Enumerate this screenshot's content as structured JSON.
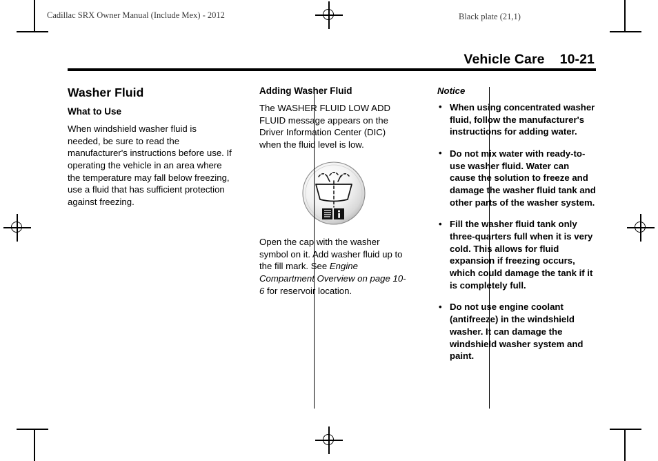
{
  "running_head": {
    "left": "Cadillac SRX Owner Manual (Include Mex) - 2012",
    "right": "Black plate (21,1)"
  },
  "page_header": {
    "section_title": "Vehicle Care",
    "page_number": "10-21"
  },
  "columns": {
    "left": {
      "heading": "Washer Fluid",
      "subheading": "What to Use",
      "paragraph": "When windshield washer fluid is needed, be sure to read the manufacturer's instructions before use. If operating the vehicle in an area where the temperature may fall below freezing, use a fluid that has sufficient protection against freezing."
    },
    "middle": {
      "heading": "Adding Washer Fluid",
      "paragraph_1": "The WASHER FLUID LOW ADD FLUID message appears on the Driver Information Center (DIC) when the fluid level is low.",
      "figure_name": "washer-fluid-cap-symbol",
      "paragraph_2_part_1": "Open the cap with the washer symbol on it. Add washer fluid up to the fill mark. See ",
      "paragraph_2_xref": "Engine Compartment Overview on page 10-6",
      "paragraph_2_part_2": " for reservoir location."
    },
    "right": {
      "notice_label": "Notice",
      "bullet_marker": "•",
      "bullets": [
        "When using concentrated washer fluid, follow the manufacturer's instructions for adding water.",
        "Do not mix water with ready-to-use washer fluid. Water can cause the solution to freeze and damage the washer fluid tank and other parts of the washer system.",
        "Fill the washer fluid tank only three-quarters full when it is very cold. This allows for fluid expansion if freezing occurs, which could damage the tank if it is completely full.",
        "Do not use engine coolant (antifreeze) in the windshield washer. It can damage the windshield washer system and paint."
      ]
    }
  },
  "colors": {
    "text": "#000000",
    "running_head": "#3a3a3a",
    "rule": "#000000"
  }
}
